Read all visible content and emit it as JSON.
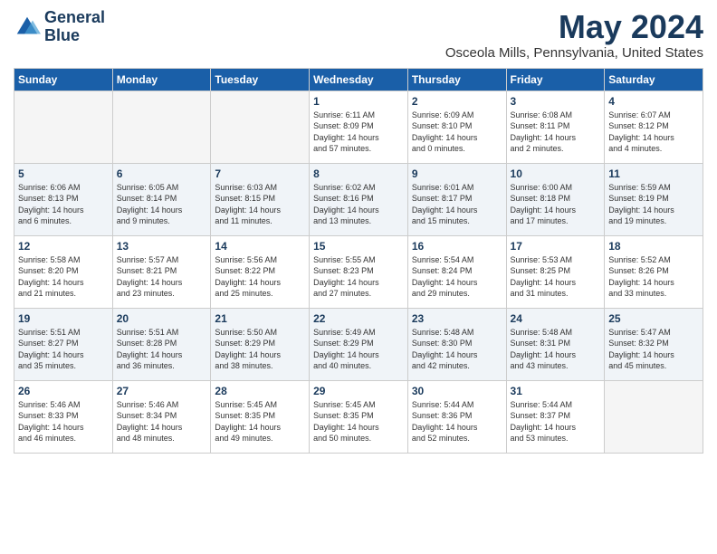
{
  "header": {
    "logo_line1": "General",
    "logo_line2": "Blue",
    "month_title": "May 2024",
    "location": "Osceola Mills, Pennsylvania, United States"
  },
  "days_of_week": [
    "Sunday",
    "Monday",
    "Tuesday",
    "Wednesday",
    "Thursday",
    "Friday",
    "Saturday"
  ],
  "weeks": [
    [
      {
        "day": "",
        "info": ""
      },
      {
        "day": "",
        "info": ""
      },
      {
        "day": "",
        "info": ""
      },
      {
        "day": "1",
        "info": "Sunrise: 6:11 AM\nSunset: 8:09 PM\nDaylight: 14 hours\nand 57 minutes."
      },
      {
        "day": "2",
        "info": "Sunrise: 6:09 AM\nSunset: 8:10 PM\nDaylight: 14 hours\nand 0 minutes."
      },
      {
        "day": "3",
        "info": "Sunrise: 6:08 AM\nSunset: 8:11 PM\nDaylight: 14 hours\nand 2 minutes."
      },
      {
        "day": "4",
        "info": "Sunrise: 6:07 AM\nSunset: 8:12 PM\nDaylight: 14 hours\nand 4 minutes."
      }
    ],
    [
      {
        "day": "5",
        "info": "Sunrise: 6:06 AM\nSunset: 8:13 PM\nDaylight: 14 hours\nand 6 minutes."
      },
      {
        "day": "6",
        "info": "Sunrise: 6:05 AM\nSunset: 8:14 PM\nDaylight: 14 hours\nand 9 minutes."
      },
      {
        "day": "7",
        "info": "Sunrise: 6:03 AM\nSunset: 8:15 PM\nDaylight: 14 hours\nand 11 minutes."
      },
      {
        "day": "8",
        "info": "Sunrise: 6:02 AM\nSunset: 8:16 PM\nDaylight: 14 hours\nand 13 minutes."
      },
      {
        "day": "9",
        "info": "Sunrise: 6:01 AM\nSunset: 8:17 PM\nDaylight: 14 hours\nand 15 minutes."
      },
      {
        "day": "10",
        "info": "Sunrise: 6:00 AM\nSunset: 8:18 PM\nDaylight: 14 hours\nand 17 minutes."
      },
      {
        "day": "11",
        "info": "Sunrise: 5:59 AM\nSunset: 8:19 PM\nDaylight: 14 hours\nand 19 minutes."
      }
    ],
    [
      {
        "day": "12",
        "info": "Sunrise: 5:58 AM\nSunset: 8:20 PM\nDaylight: 14 hours\nand 21 minutes."
      },
      {
        "day": "13",
        "info": "Sunrise: 5:57 AM\nSunset: 8:21 PM\nDaylight: 14 hours\nand 23 minutes."
      },
      {
        "day": "14",
        "info": "Sunrise: 5:56 AM\nSunset: 8:22 PM\nDaylight: 14 hours\nand 25 minutes."
      },
      {
        "day": "15",
        "info": "Sunrise: 5:55 AM\nSunset: 8:23 PM\nDaylight: 14 hours\nand 27 minutes."
      },
      {
        "day": "16",
        "info": "Sunrise: 5:54 AM\nSunset: 8:24 PM\nDaylight: 14 hours\nand 29 minutes."
      },
      {
        "day": "17",
        "info": "Sunrise: 5:53 AM\nSunset: 8:25 PM\nDaylight: 14 hours\nand 31 minutes."
      },
      {
        "day": "18",
        "info": "Sunrise: 5:52 AM\nSunset: 8:26 PM\nDaylight: 14 hours\nand 33 minutes."
      }
    ],
    [
      {
        "day": "19",
        "info": "Sunrise: 5:51 AM\nSunset: 8:27 PM\nDaylight: 14 hours\nand 35 minutes."
      },
      {
        "day": "20",
        "info": "Sunrise: 5:51 AM\nSunset: 8:28 PM\nDaylight: 14 hours\nand 36 minutes."
      },
      {
        "day": "21",
        "info": "Sunrise: 5:50 AM\nSunset: 8:29 PM\nDaylight: 14 hours\nand 38 minutes."
      },
      {
        "day": "22",
        "info": "Sunrise: 5:49 AM\nSunset: 8:29 PM\nDaylight: 14 hours\nand 40 minutes."
      },
      {
        "day": "23",
        "info": "Sunrise: 5:48 AM\nSunset: 8:30 PM\nDaylight: 14 hours\nand 42 minutes."
      },
      {
        "day": "24",
        "info": "Sunrise: 5:48 AM\nSunset: 8:31 PM\nDaylight: 14 hours\nand 43 minutes."
      },
      {
        "day": "25",
        "info": "Sunrise: 5:47 AM\nSunset: 8:32 PM\nDaylight: 14 hours\nand 45 minutes."
      }
    ],
    [
      {
        "day": "26",
        "info": "Sunrise: 5:46 AM\nSunset: 8:33 PM\nDaylight: 14 hours\nand 46 minutes."
      },
      {
        "day": "27",
        "info": "Sunrise: 5:46 AM\nSunset: 8:34 PM\nDaylight: 14 hours\nand 48 minutes."
      },
      {
        "day": "28",
        "info": "Sunrise: 5:45 AM\nSunset: 8:35 PM\nDaylight: 14 hours\nand 49 minutes."
      },
      {
        "day": "29",
        "info": "Sunrise: 5:45 AM\nSunset: 8:35 PM\nDaylight: 14 hours\nand 50 minutes."
      },
      {
        "day": "30",
        "info": "Sunrise: 5:44 AM\nSunset: 8:36 PM\nDaylight: 14 hours\nand 52 minutes."
      },
      {
        "day": "31",
        "info": "Sunrise: 5:44 AM\nSunset: 8:37 PM\nDaylight: 14 hours\nand 53 minutes."
      },
      {
        "day": "",
        "info": ""
      }
    ]
  ]
}
